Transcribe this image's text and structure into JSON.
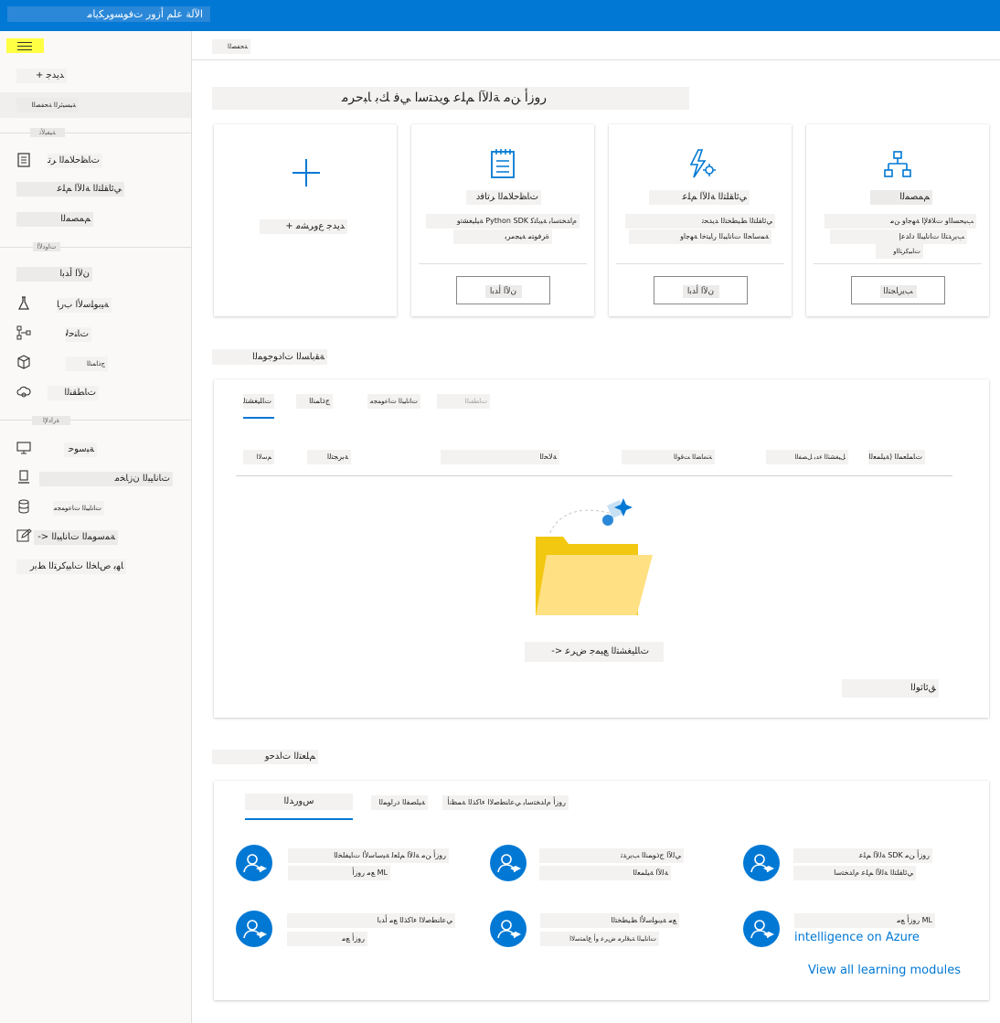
{
  "app": {
    "title": "ﺍﻵﻟﺔ ﻋﻠﻢ ﺃﺯﻭﺭ ﺕﻓﻮﺴﻭﺮﻜﻳﺎﻣ"
  },
  "sidebar": {
    "items": [
      {
        "label": "ﺪﻳﺪﺟ +"
      },
      {
        "label": "ﺔﻴﺴﻴﺋﺮﻟﺍ ﺔﺤﻔﺼﻟﺍ"
      },
      {
        "label": "ﺕﺎﻈﺣﻼﻤﻟﺍ ﺮﺗﺎﻓﺩ"
      },
      {
        "label": "ﻲﺋﺎﻘﻠﺘﻟﺍ ﺔﻟﻵﺍ ﻢﻠﻋ"
      },
      {
        "label": "ﻢﻤﺼﻤﻟﺍ"
      },
      {
        "label": "ﻥﻵﺍ ﺃﺪﺑﺍ"
      },
      {
        "label": "ﺔﻴﺑﻮﻠﺳﻷﺍ ﺏﺭﺎﺠﺘﻟﺍ"
      },
      {
        "label": "ﺕﺎﻨﺣﻻﺍ"
      },
      {
        "label": "ﺝﺫﺎﻤﻨﻟﺍ"
      },
      {
        "label": "ﺕﺎﻄﻘﻨﻟﺍ"
      },
      {
        "label": "ﺔﺒﺳﻮﺣ"
      },
      {
        "label": "ﺕﺎﻧﺎﻴﺒﻟﺍ ﻥﺯﺎﺨﻣ"
      },
      {
        "label": "ﺕﺎﻧﺎﻴﺒﻟﺍ ﺕﺎﻋﻮﻤﺠﻣ"
      },
      {
        "label": "ﺔﻤﺳﻮﻤﻟﺍ ﺕﺎﻧﺎﻴﺒﻟﺍ <-"
      },
      {
        "label": "ﺎﻬﺑ ﺹﺎﺨﻟﺍ ﺕﺎﺒﻴﻛﺮﺘﻟﺍ ﻂﺑﺭ"
      }
    ],
    "sections": [
      "ﺔﻴﻔﻴﻟﺄﺗ",
      "ﺕﺍﻭﺩﻷﺍ",
      "ﺓﺭﺍﺩﻹﺍ"
    ]
  },
  "breadcrumb": {
    "label": "ﺔﺤﻔﺼﻟﺍ"
  },
  "hero": {
    "title": "ﺭﻭﺯﺃ ﻦﻣ ﺔﻟﻵﺍ ﻢﻠﻋ ﻮﻳﺪﺘﺳﺍ ﻲﻓ ﻚﺑ ﺎﺒﺣﺮﻣ"
  },
  "cards": [
    {
      "title": "ﺪﻳﺪﺟ ﻉﻭﺮﺸﻣ +",
      "button": ""
    },
    {
      "title": "ﺕﺎﻈﺣﻼﻤﻟﺍ ﺮﺗﺎﻓﺩ",
      "desc1": "ﻡﺍﺪﺨﺘﺳﺎﺑ ﺔﻴﺑﺎﺘﻛ Python SDK ﺔﻴﻠﻴﻐﺸﺗﻭ",
      "desc2": "ﺓﺮﻓﻮﺘﻣ ﺔﻴﺠﻣﺮﺑ",
      "button": "ﻥﻵﺍ ﺃﺪﺑﺍ"
    },
    {
      "title": "ﻲﺋﺎﻘﻠﺘﻟﺍ ﺔﻟﻵﺍ ﻢﻠﻋ",
      "desc1": "ﻲﺋﺎﻘﻠﺘﻟﺍ ﻂﻴﻄﺨﺘﻟﺍ ﺪﻳﺪﺤﺗ",
      "desc2": "ﺔﻤﺳﺎﺤﻟﺍ ﺕﺎﻧﺎﻴﺒﻟﺍ ﺭﺎﻴﺘﺧﺍ ﺔﻬﺟﺍﻭ",
      "button": "ﻥﻵﺍ ﺃﺪﺑﺍ"
    },
    {
      "title": "ﻢﻤﺼﻤﻟﺍ",
      "desc1": "ﺐﻴﺤﺴﻟﺍﻭ ﺕﻼﻓﻹﺍ ﺔﻬﺟﺍﻭ ﻦﻣ",
      "desc2": "ﺐﻳﺭﺪﺘﻟﺍ ﺕﺎﻧﺎﻴﺒﻟﺍ ﺩﺍﺪﻋﺇ",
      "desc3": "ﺕﺎﺒﻴﻛﺮﺘﻟﺍﻭ",
      "button": "ﺐﻳﺭﺎﺠﺘﻟﺍ"
    }
  ],
  "recent": {
    "title": "ﺔﻘﺑﺎﺴﻟﺍ ﺕﺍﺩﻮﺟﻮﻤﻟﺍ",
    "tabs": [
      "ﺕﺎﻠﻴﻐﺸﺘﻟﺍ",
      "ﺝﺫﺎﻤﻨﻟﺍ",
      "ﺕﺎﻧﺎﻴﺒﻟﺍ ﺕﺎﻋﻮﻤﺠﻣ",
      "ﺕﺎﻄﻘﻨﻟﺍ"
    ],
    "columns": [
      "ﻢﺳﻻﺍ",
      "ﺔﺑﺮﺠﺘﻟﺍ",
      "ﺔﻟﺎﺤﻟﺍ",
      "ﺔﻨﻣﺎﻀﻟﺍ ﺖﻗﻮﻟﺍ",
      "ﻞﻴﻐﺸﺘﻟﺍ ﺀﺪﺑ ﻞﺼﻔﻟﺍ",
      "ﻞﻴﻐﺸﺘﻟﺍ ﺕﻼﺼﻔﻟﺍ",
      "ﺕﺎﻤﻠﻌﻤﻟﺍ (ﺔﻴﻠﻤﻌﻟﺍ)"
    ],
    "empty_action": "ﺕﺎﻠﻴﻐﺸﺘﻟﺍ ﻊﻴﻤﺟ ﺽﺮﻋ <-",
    "docs": "ﻖﺋﺎﺛﻮﻟﺍ"
  },
  "learn": {
    "title": "ﻢﻠﻌﺘﻟﺍ ﺕﺍﺪﺣﻭ",
    "tabs": [
      "ﺱﻭﺭﺪﻟﺍ",
      "ﺔﻴﻠﺼﻔﻟﺍ ﺩﺭﺍﻮﻤﻟﺍ",
      "ﺭﻭﺯﺃ ﻡﺍﺪﺨﺘﺳﺎﺑ ﻲﻋﺎﻨﻄﺻﻻﺍ ﺀﺎﻛﺬﻟﺍ ﺔﻤﻈﻧﺃ"
    ],
    "modules": [
      {
        "line1": "ﺭﻭﺯﺃ ﻦﻣ ﺔﻟﻵﺍ ﻢﻠﻌﻟ ﺔﻴﺳﺎﺳﻷﺍ ﺕﺎﻴﻔﻠﺨﻟﺍ",
        "line2": "ML ﻊﻣ ﺭﻭﺯﺃ"
      },
      {
        "line1": "ﻲﻟﻵﺍ ﺝﺫﻮﻤﻨﻟﺍ ﺐﻳﺭﺪﺗ",
        "line2": "ﺔﻟﻵﺍ ﺔﻴﻠﻤﻌﻟﺍ"
      },
      {
        "line1": "ﺭﻭﺯﺃ ﻦﻣ SDK ﺔﻟﻵﺍ ﻢﻠﻋ",
        "line2": "ﻲﺋﺎﻘﻠﺘﻟﺍ ﺔﻟﻵﺍ ﻢﻠﻋ ﻡﺍﺪﺨﺘﺳﺍ"
      },
      {
        "line1": "ﻲﻋﺎﻨﻄﺻﻻﺍ ﺀﺎﻛﺬﻟﺍ ﻊﻣ ﺃﺪﺑﺍ",
        "line2": "ﺭﻭﺯﺃ ﻊﻣ"
      },
      {
        "line1": "ﻊﻣ ﺔﻴﺑﻮﻠﺳﻷﺍ ﻂﻴﻄﺨﺘﻟﺍ",
        "line2": "ﺕﺎﻧﺎﻴﺒﻟﺍ ﺔﺒﻗﺍﺮﻣ ﺽﺮﻋ ﻭﺃ ﻉﺎﻤﺘﺳﻻﺍ"
      },
      {
        "line1": "ML ﺭﻭﺯﺃ ﻊﻣ",
        "line2": "intelligence on Azure"
      }
    ],
    "view_all": "View all learning modules"
  }
}
